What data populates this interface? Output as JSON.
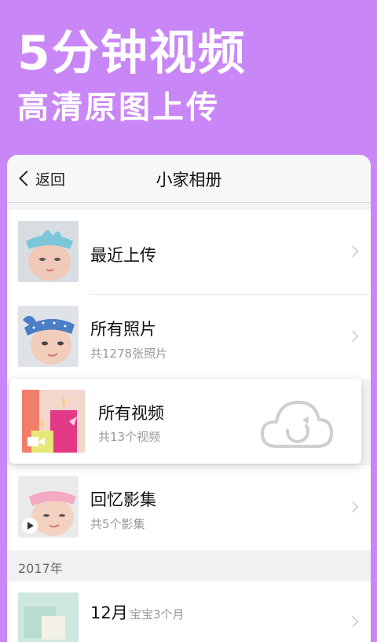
{
  "promo": {
    "headline": "5分钟视频",
    "subheadline": "高清原图上传"
  },
  "nav": {
    "back_label": "返回",
    "title": "小家相册"
  },
  "albums": [
    {
      "title": "最近上传",
      "subtitle": ""
    },
    {
      "title": "所有照片",
      "subtitle": "共1278张照片"
    },
    {
      "title": "所有视频",
      "subtitle": "共13个视频"
    },
    {
      "title": "回忆影集",
      "subtitle": "共5个影集"
    }
  ],
  "section": {
    "year": "2017年"
  },
  "month_row": {
    "title": "12月",
    "subtitle": "宝宝3个月"
  },
  "colors": {
    "background": "#c986f6",
    "panel": "#f4f4f6"
  },
  "icons": [
    "back-chevron-icon",
    "chevron-right-icon",
    "video-camera-icon",
    "play-icon",
    "cloud-upload-icon"
  ]
}
